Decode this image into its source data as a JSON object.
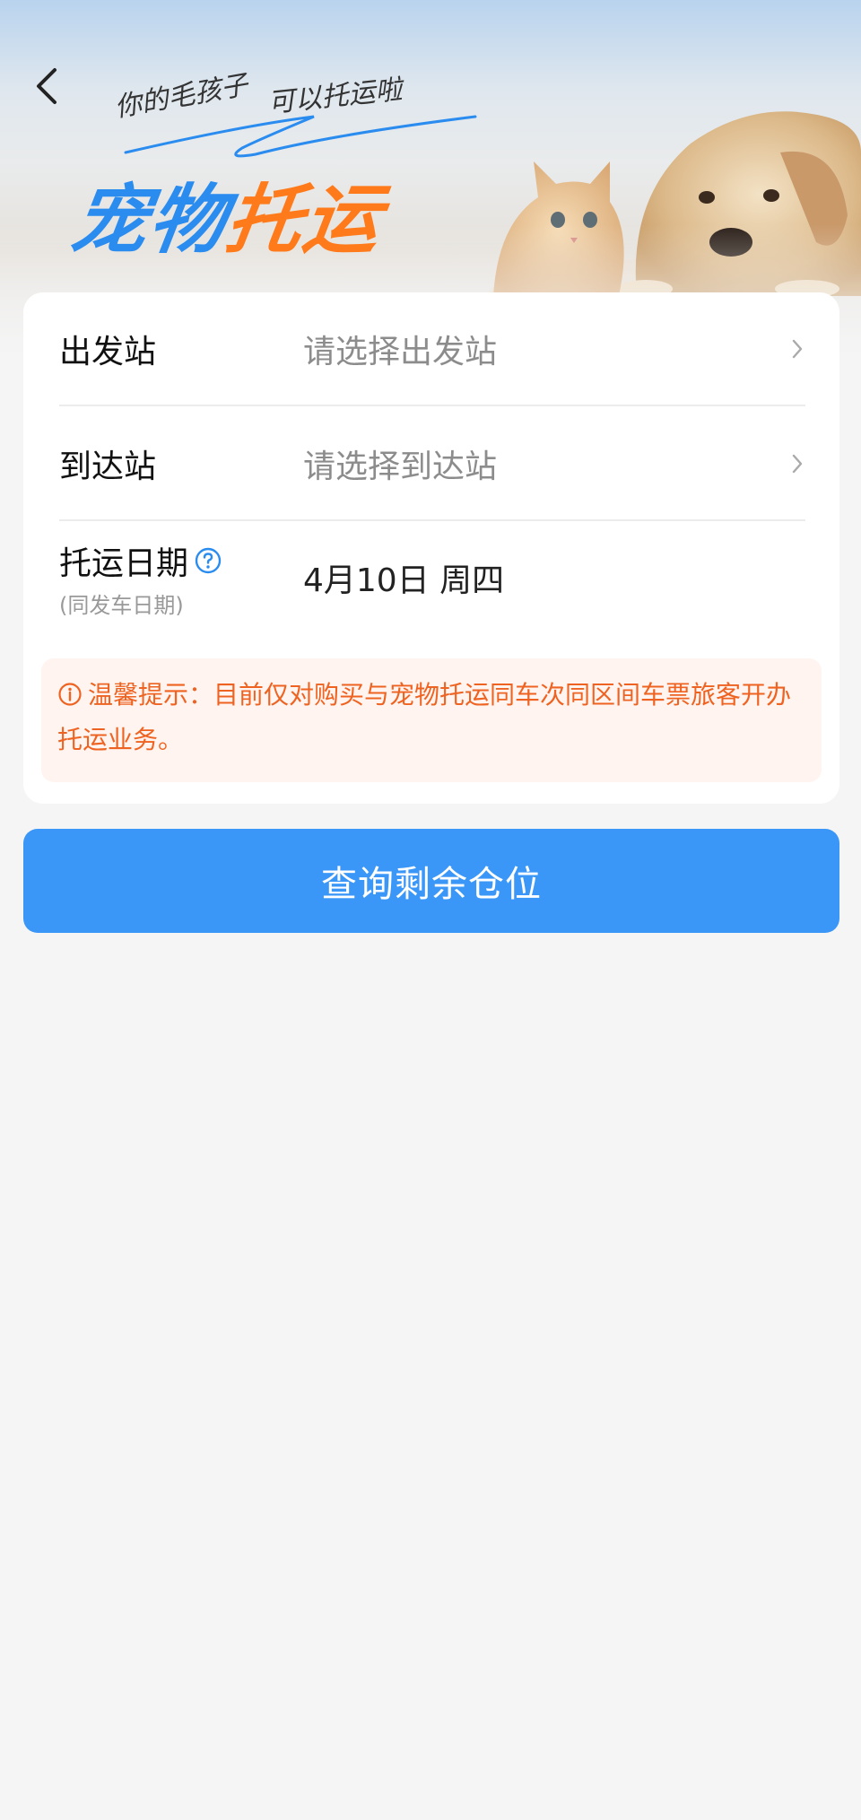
{
  "banner": {
    "slogan_line1": "你的毛孩子",
    "slogan_line2": "可以托运啦",
    "title_part1": "宠物",
    "title_part2": "托运",
    "title_colors": [
      "#2b8cf0",
      "#ff7a1a"
    ],
    "back_icon": "chevron-left-icon"
  },
  "form": {
    "departure": {
      "label": "出发站",
      "placeholder": "请选择出发站"
    },
    "arrival": {
      "label": "到达站",
      "placeholder": "请选择到达站"
    },
    "date": {
      "label": "托运日期",
      "sublabel": "(同发车日期)",
      "value": "4月10日 周四",
      "help_icon": "question-circle-icon"
    }
  },
  "tip": {
    "icon": "info-circle-icon",
    "text": "温馨提示：目前仅对购买与宠物托运同车次同区间车票旅客开办托运业务。",
    "color": "#ee6321"
  },
  "query_button": {
    "label": "查询剩余仓位",
    "color": "#3a97f8"
  }
}
